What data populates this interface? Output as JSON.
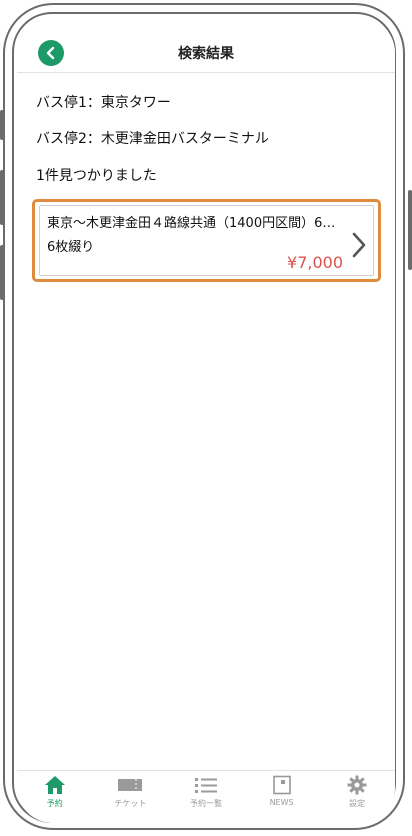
{
  "header": {
    "title": "検索結果"
  },
  "search": {
    "stop1": "バス停1：東京タワー",
    "stop2": "バス停2：木更津金田バスターミナル",
    "count": "1件見つかりました"
  },
  "results": [
    {
      "title": "東京〜木更津金田４路線共通（1400円区間）6枚綴り",
      "subtitle": "6枚綴り",
      "price": "¥7,000"
    }
  ],
  "tabs": [
    {
      "label": "予約",
      "icon": "home-icon",
      "active": true
    },
    {
      "label": "チケット",
      "icon": "ticket-icon",
      "active": false
    },
    {
      "label": "予約一覧",
      "icon": "list-icon",
      "active": false
    },
    {
      "label": "NEWS",
      "icon": "news-icon",
      "active": false
    },
    {
      "label": "設定",
      "icon": "gear-icon",
      "active": false
    }
  ],
  "colors": {
    "accent": "#1d9a67",
    "price": "#d9534f",
    "highlight": "#e08a3c",
    "inactive": "#9a9a9a"
  }
}
